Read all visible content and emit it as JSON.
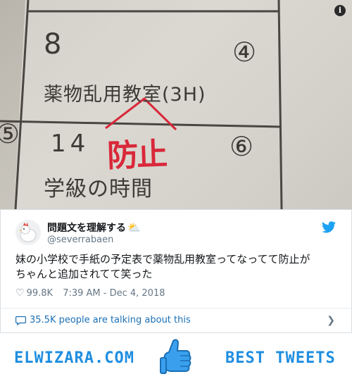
{
  "photo": {
    "row1_number": "8",
    "row1_circle": "④",
    "row1_class": "薬物乱用教室(3H)",
    "row2_circle_left": "⑤",
    "row2_number": "14",
    "row2_circle": "⑥",
    "row2_handwriting": "防止",
    "row2_class": "学級の時間",
    "info_icon": "i"
  },
  "tweet": {
    "display_name": "問題文を理解する",
    "name_emoji": "⛅",
    "handle": "@severrabaen",
    "text_line1": "妹の小学校で手紙の予定表で薬物乱用教室ってなってて防止が",
    "text_line2": "ちゃんと追加されてて笑った",
    "likes": "99.8K",
    "timestamp": "7:39 AM - Dec 4, 2018",
    "talking": "35.5K people are talking about this",
    "icons": {
      "bird": "twitter-bird-icon",
      "heart": "heart-icon",
      "bubble": "speech-bubble-icon",
      "chevron": "chevron-right-icon"
    }
  },
  "footer": {
    "site": "ELWIZARA.COM",
    "tagline": "BEST TWEETS",
    "accent": "#1f8ee0"
  }
}
